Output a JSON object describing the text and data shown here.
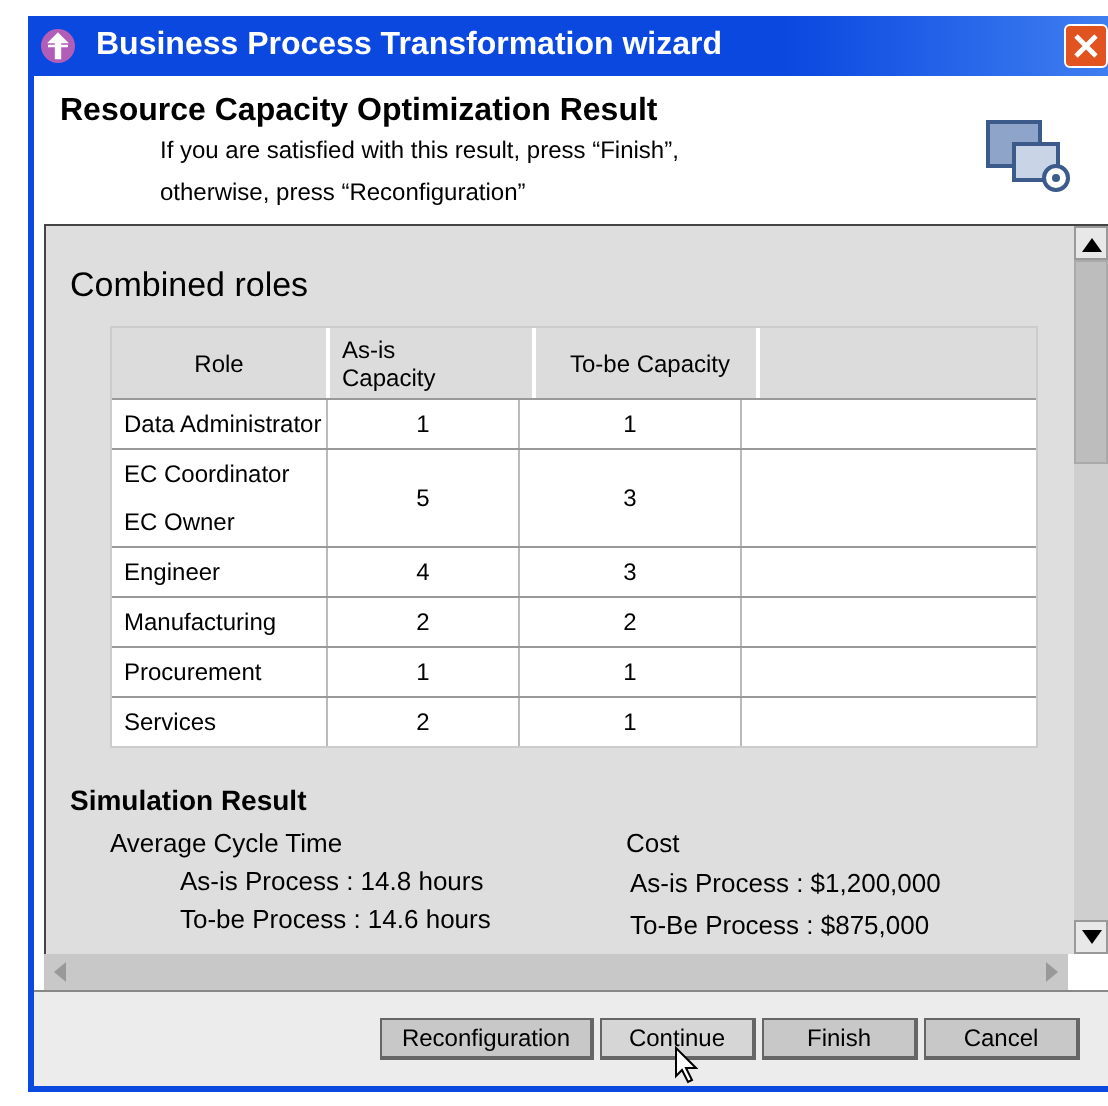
{
  "window": {
    "title": "Business Process Transformation wizard"
  },
  "header": {
    "title": "Resource Capacity Optimization Result",
    "lines": [
      "If you are satisfied with this result, press “Finish”,",
      "otherwise, press “Reconfiguration”"
    ]
  },
  "roles_section": {
    "title": "Combined roles",
    "columns": [
      "Role",
      "As-is Capacity",
      "To-be Capacity"
    ],
    "rows": [
      {
        "roles": [
          "Data Administrator"
        ],
        "as_is": "1",
        "to_be": "1"
      },
      {
        "roles": [
          "EC Coordinator",
          "EC Owner"
        ],
        "as_is": "5",
        "to_be": "3"
      },
      {
        "roles": [
          "Engineer"
        ],
        "as_is": "4",
        "to_be": "3"
      },
      {
        "roles": [
          "Manufacturing"
        ],
        "as_is": "2",
        "to_be": "2"
      },
      {
        "roles": [
          "Procurement"
        ],
        "as_is": "1",
        "to_be": "1"
      },
      {
        "roles": [
          "Services"
        ],
        "as_is": "2",
        "to_be": "1"
      }
    ]
  },
  "simulation": {
    "title": "Simulation Result",
    "groups": [
      {
        "title": "Average Cycle Time",
        "lines": [
          "As-is Process  : 14.8 hours",
          "To-be Process : 14.6 hours"
        ]
      },
      {
        "title": "Cost",
        "lines": [
          "As-is Process  : $1,200,000",
          "To-Be Process  : $875,000"
        ]
      }
    ]
  },
  "buttons": [
    {
      "label": "Reconfiguration",
      "hovered": false
    },
    {
      "label": "Continue",
      "hovered": true
    },
    {
      "label": "Finish",
      "hovered": false
    },
    {
      "label": "Cancel",
      "hovered": false
    }
  ]
}
